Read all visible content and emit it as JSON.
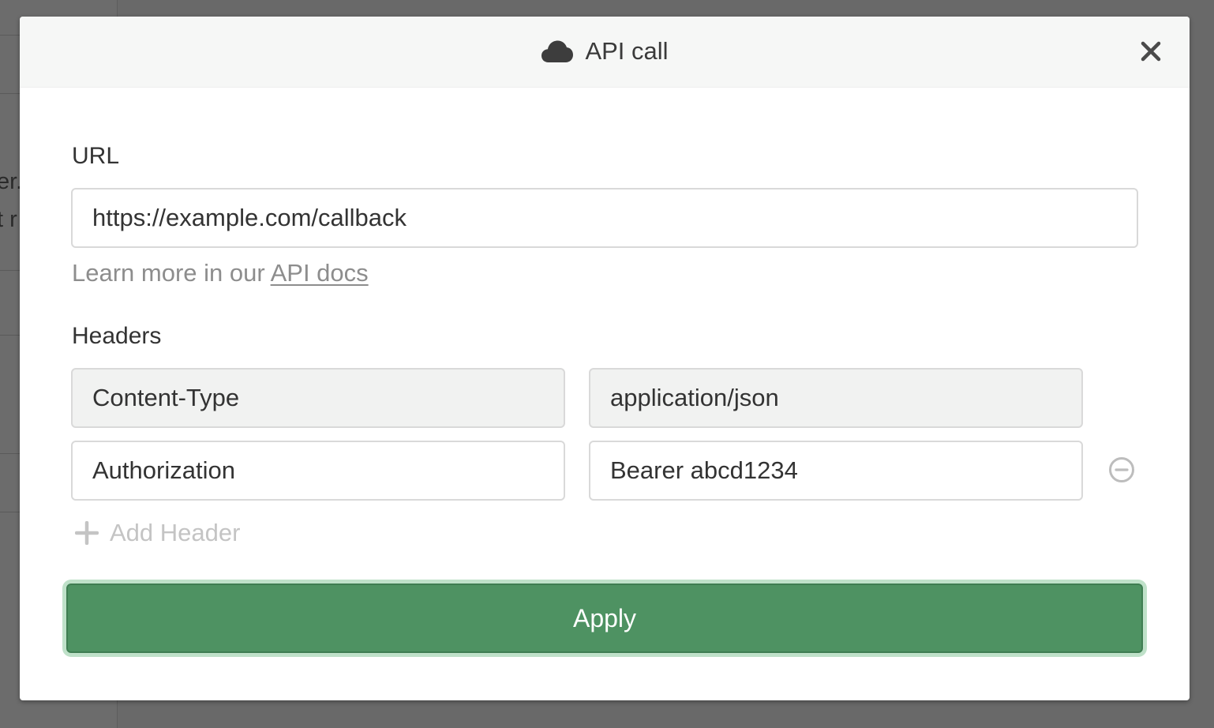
{
  "background": {
    "fragments": [
      "er.",
      "t r"
    ]
  },
  "modal": {
    "title": "API call",
    "title_icon": "cloud-icon",
    "close_icon": "close-icon"
  },
  "url_field": {
    "label": "URL",
    "value": "https://example.com/callback",
    "help_prefix": "Learn more in our ",
    "help_link": "API docs"
  },
  "headers": {
    "label": "Headers",
    "rows": [
      {
        "name": "Content-Type",
        "value": "application/json",
        "readonly": true,
        "removable": false
      },
      {
        "name": "Authorization",
        "value": "Bearer abcd1234",
        "readonly": false,
        "removable": true
      }
    ],
    "add_label": "Add Header",
    "remove_icon": "minus-circle-icon",
    "add_icon": "plus-icon"
  },
  "actions": {
    "apply_label": "Apply"
  },
  "colors": {
    "apply_bg": "#4e9262",
    "apply_focus_ring": "#bfe1c9",
    "overlay": "#696969"
  }
}
